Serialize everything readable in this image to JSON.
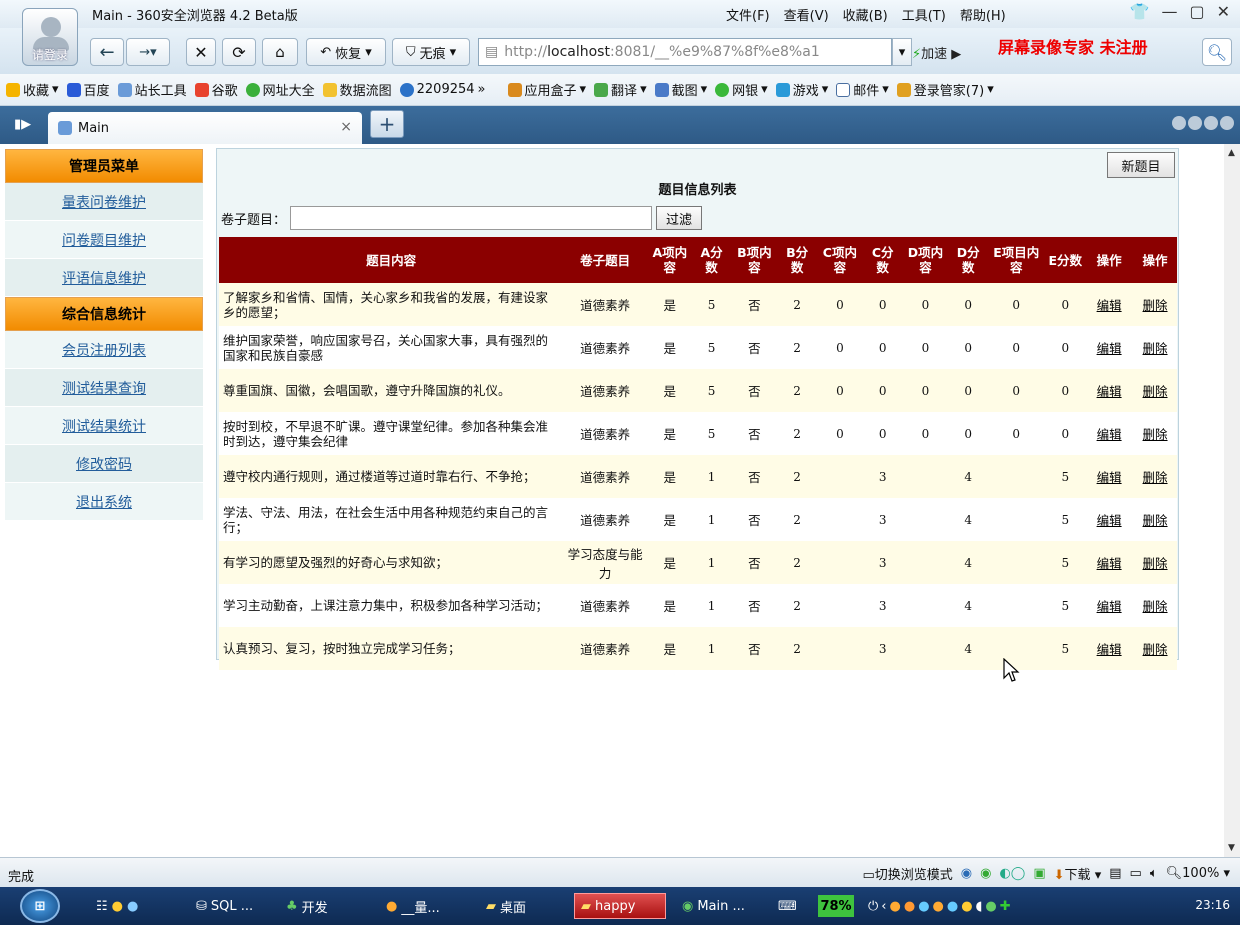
{
  "window": {
    "title": "Main - 360安全浏览器 4.2 Beta版",
    "avatar_label": "请登录",
    "menus": [
      "文件(F)",
      "查看(V)",
      "收藏(B)",
      "工具(T)",
      "帮助(H)"
    ]
  },
  "navbar": {
    "restore_label": "恢复",
    "notrace_label": "无痕",
    "address_prefix": "http://",
    "address_host": "localhost",
    "address_rest": ":8081/__%e9%87%8f%e8%a1",
    "speed_label": "加速",
    "watermark": "屏幕录像专家  未注册"
  },
  "bookmarks": [
    "收藏",
    "百度",
    "站长工具",
    "谷歌",
    "网址大全",
    "数据流图",
    "2209254",
    "应用盒子",
    "翻译",
    "截图",
    "网银",
    "游戏",
    "邮件",
    "登录管家(7)"
  ],
  "tab": {
    "label": "Main"
  },
  "sidebar": {
    "admin_header": "管理员菜单",
    "admin_items": [
      "量表问卷维护",
      "问卷题目维护",
      "评语信息维护"
    ],
    "stats_header": "综合信息统计",
    "stats_items": [
      "会员注册列表",
      "测试结果查询",
      "测试结果统计",
      "修改密码",
      "退出系统"
    ]
  },
  "main": {
    "new_button": "新题目",
    "list_title": "题目信息列表",
    "filter_label": "卷子题目：",
    "filter_value": "",
    "filter_button": "过滤",
    "columns": [
      "题目内容",
      "卷子题目",
      "A项内容",
      "A分数",
      "B项内容",
      "B分数",
      "C项内容",
      "C分数",
      "D项内容",
      "D分数",
      "E项目内容",
      "E分数",
      "操作",
      "操作"
    ],
    "edit_label": "编辑",
    "delete_label": "删除",
    "rows": [
      [
        "了解家乡和省情、国情，关心家乡和我省的发展，有建设家乡的愿望；",
        "道德素养",
        "是",
        "5",
        "否",
        "2",
        "0",
        "0",
        "0",
        "0",
        "0",
        "0"
      ],
      [
        "维护国家荣誉，响应国家号召，关心国家大事，具有强烈的国家和民族自豪感",
        "道德素养",
        "是",
        "5",
        "否",
        "2",
        "0",
        "0",
        "0",
        "0",
        "0",
        "0"
      ],
      [
        "尊重国旗、国徽，会唱国歌，遵守升降国旗的礼仪。",
        "道德素养",
        "是",
        "5",
        "否",
        "2",
        "0",
        "0",
        "0",
        "0",
        "0",
        "0"
      ],
      [
        "按时到校，不早退不旷课。遵守课堂纪律。参加各种集会准时到达，遵守集会纪律",
        "道德素养",
        "是",
        "5",
        "否",
        "2",
        "0",
        "0",
        "0",
        "0",
        "0",
        "0"
      ],
      [
        "遵守校内通行规则，通过楼道等过道时靠右行、不争抢；",
        "道德素养",
        "是",
        "1",
        "否",
        "2",
        "",
        "3",
        "",
        "4",
        "",
        "5"
      ],
      [
        "学法、守法、用法，在社会生活中用各种规范约束自己的言行；",
        "道德素养",
        "是",
        "1",
        "否",
        "2",
        "",
        "3",
        "",
        "4",
        "",
        "5"
      ],
      [
        "有学习的愿望及强烈的好奇心与求知欲；",
        "学习态度与能力",
        "是",
        "1",
        "否",
        "2",
        "",
        "3",
        "",
        "4",
        "",
        "5"
      ],
      [
        "学习主动勤奋，上课注意力集中，积极参加各种学习活动；",
        "道德素养",
        "是",
        "1",
        "否",
        "2",
        "",
        "3",
        "",
        "4",
        "",
        "5"
      ],
      [
        "认真预习、复习，按时独立完成学习任务；",
        "道德素养",
        "是",
        "1",
        "否",
        "2",
        "",
        "3",
        "",
        "4",
        "",
        "5"
      ]
    ]
  },
  "statusbar": {
    "status": "完成",
    "mode_label": "切换浏览模式",
    "download_label": "下载",
    "zoom": "100%"
  },
  "taskbar": {
    "items": [
      "SQL ...",
      "开发",
      "__量...",
      "桌面",
      "happy",
      "Main ..."
    ],
    "battery": "78%",
    "time": "23:16"
  },
  "colors": {
    "table_header": "#8b0000",
    "menu_header": "#f28b00",
    "row_alt": "#fffce6",
    "link": "#225d9b"
  }
}
